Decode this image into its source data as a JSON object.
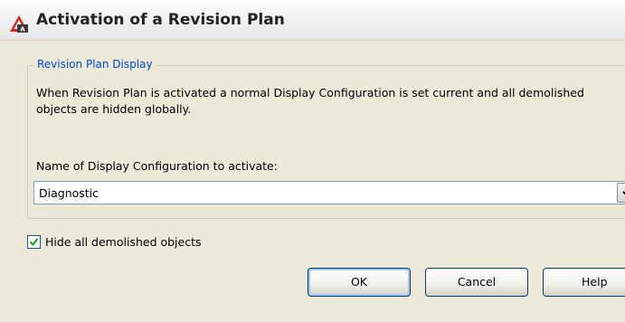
{
  "window": {
    "title": "Activation of a Revision Plan",
    "icon": "autocad-app-icon"
  },
  "group": {
    "legend": "Revision Plan Display",
    "description": "When Revision Plan is activated a normal Display Configuration is set current and all demolished objects are hidden globally."
  },
  "display_config": {
    "label": "Name of Display Configuration to activate:",
    "selected": "Diagnostic"
  },
  "hide_demolished": {
    "label": "Hide all demolished objects",
    "checked": true
  },
  "buttons": {
    "ok": "OK",
    "cancel": "Cancel",
    "help": "Help"
  },
  "colors": {
    "legend_text": "#0046d5",
    "dialog_background": "#ece9d8",
    "checkmark": "#21a121",
    "icon_red": "#d52b1e"
  }
}
